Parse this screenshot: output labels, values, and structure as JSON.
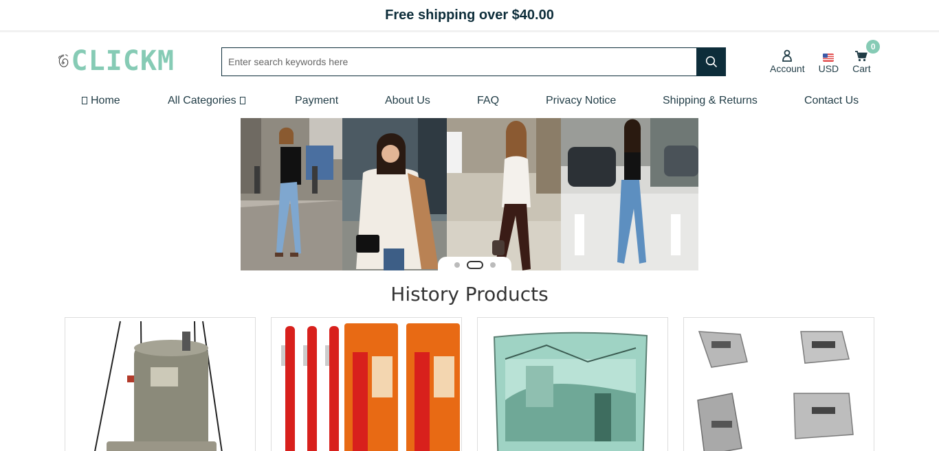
{
  "promo": {
    "text": "Free shipping over $40.00"
  },
  "logo": {
    "text": "CLICKM"
  },
  "search": {
    "placeholder": "Enter search keywords here"
  },
  "header_tools": {
    "account_label": "Account",
    "currency_label": "USD",
    "cart_label": "Cart",
    "cart_count": "0"
  },
  "nav": [
    {
      "label": "Home"
    },
    {
      "label": "All Categories"
    },
    {
      "label": "Payment"
    },
    {
      "label": "About Us"
    },
    {
      "label": "FAQ"
    },
    {
      "label": "Privacy Notice"
    },
    {
      "label": "Shipping & Returns"
    },
    {
      "label": "Contact Us"
    }
  ],
  "carousel": {
    "slide_count": 3,
    "active_index": 1
  },
  "section": {
    "title": "History Products"
  },
  "colors": {
    "brand": "#86cbb5",
    "dark": "#0d2d3a",
    "text": "#1f3b45"
  },
  "icons": [
    "search-icon",
    "user-icon",
    "us-flag-icon",
    "cart-icon",
    "home-icon",
    "chevron-down-icon"
  ]
}
